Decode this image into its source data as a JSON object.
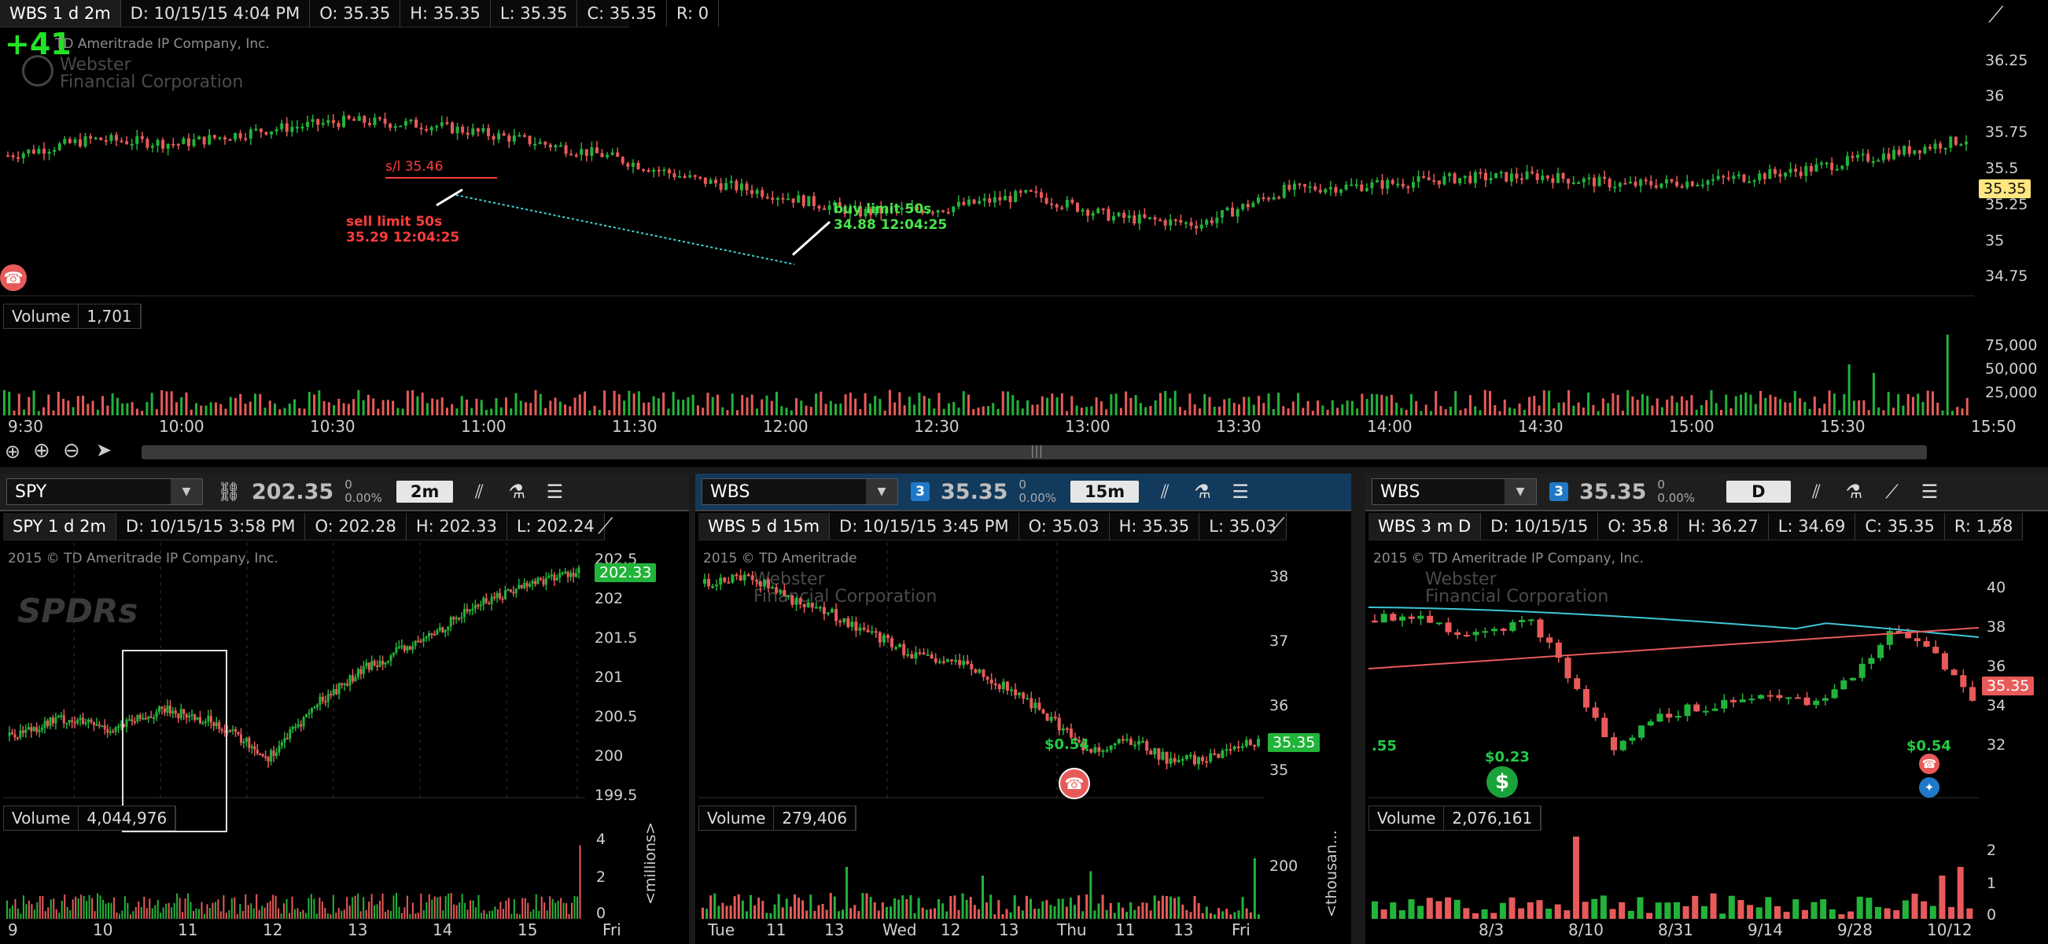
{
  "main": {
    "info": [
      "WBS 1 d 2m",
      "D: 10/15/15 4:04 PM",
      "O: 35.35",
      "H: 35.35",
      "L: 35.35",
      "C: 35.35",
      "R: 0"
    ],
    "pl": "+41",
    "copyright": "TD Ameritrade IP Company, Inc.",
    "watermark_l1": "Webster",
    "watermark_l2": "Financial Corporation",
    "price_ticks": [
      "36.25",
      "36",
      "35.75",
      "35.5",
      "35.25",
      "35",
      "34.75"
    ],
    "last_tag": "35.35",
    "order_label": "s/l 35.46",
    "sell_l1": "sell limit 50s",
    "sell_l2": "35.29 12:04:25",
    "buy_l1": "buy limit 50s",
    "buy_l2": "34.88 12:04:25",
    "volume_label": "Volume",
    "volume_value": "1,701",
    "vol_ticks": [
      "75,000",
      "50,000",
      "25,000"
    ],
    "time_ticks": [
      "9:30",
      "10:00",
      "10:30",
      "11:00",
      "11:30",
      "12:00",
      "12:30",
      "13:00",
      "13:30",
      "14:00",
      "14:30",
      "15:00",
      "15:30",
      "15:50"
    ],
    "colors": {
      "up": "#22b33a",
      "down": "#e85a5a",
      "accent": "#ffe680"
    },
    "candles_up_frac": 0.52
  },
  "panels": [
    {
      "symbol": "SPY",
      "price": "202.35",
      "change": "0",
      "change_pct": "0.00%",
      "timeframe": "2m",
      "info": [
        "SPY 1 d 2m",
        "D: 10/15/15 3:58 PM",
        "O: 202.28",
        "H: 202.33",
        "L: 202.24"
      ],
      "copyright": "2015 © TD Ameritrade IP Company, Inc.",
      "watermark": "SPDRs",
      "price_ticks": [
        "202.5",
        "202",
        "201.5",
        "201",
        "200.5",
        "200",
        "199.5"
      ],
      "last_tag": "202.33",
      "volume_label": "Volume",
      "volume_value": "4,044,976",
      "vol_ticks": [
        "4",
        "2",
        "0"
      ],
      "vol_unit": "<millions>",
      "time_ticks": [
        "9",
        "10",
        "11",
        "12",
        "13",
        "14",
        "15",
        "Fri"
      ],
      "trend": [
        0.22,
        0.3,
        0.25,
        0.34,
        0.28,
        0.12,
        0.38,
        0.55,
        0.66,
        0.82,
        0.92,
        0.98
      ]
    },
    {
      "symbol": "WBS",
      "price": "35.35",
      "change": "0",
      "change_pct": "0.00%",
      "timeframe": "15m",
      "linked": "3",
      "info": [
        "WBS 5 d 15m",
        "D: 10/15/15 3:45 PM",
        "O: 35.03",
        "H: 35.35",
        "L: 35.03"
      ],
      "copyright": "2015 © TD Ameritrade",
      "watermark_l1": "Webster",
      "watermark_l2": "Financial Corporation",
      "price_ticks": [
        "38",
        "37",
        "36",
        "35"
      ],
      "last_tag": "35.35",
      "earnings": "$0.54",
      "volume_label": "Volume",
      "volume_value": "279,406",
      "vol_ticks": [
        "200"
      ],
      "vol_unit": "<thousan...",
      "time_ticks": [
        "Tue",
        "11",
        "13",
        "Wed",
        "12",
        "13",
        "Thu",
        "11",
        "13",
        "Fri"
      ],
      "trend": [
        0.92,
        0.96,
        0.85,
        0.78,
        0.68,
        0.58,
        0.55,
        0.45,
        0.32,
        0.15,
        0.2,
        0.1,
        0.12,
        0.2
      ]
    },
    {
      "symbol": "WBS",
      "price": "35.35",
      "change": "0",
      "change_pct": "0.00%",
      "timeframe": "D",
      "linked": "3",
      "info": [
        "WBS 3 m D",
        "D: 10/15/15",
        "O: 35.8",
        "H: 36.27",
        "L: 34.69",
        "C: 35.35",
        "R: 1.58"
      ],
      "copyright": "2015 © TD Ameritrade IP Company, Inc.",
      "watermark_l1": "Webster",
      "watermark_l2": "Financial Corporation",
      "price_ticks": [
        "40",
        "38",
        "36",
        "34",
        "32"
      ],
      "last_tag": "35.35",
      "div_left": ".55",
      "div_mid": "$0.23",
      "div_right": "$0.54",
      "volume_label": "Volume",
      "volume_value": "2,076,161",
      "vol_ticks": [
        "2",
        "1",
        "0"
      ],
      "time_ticks": [
        "8/3",
        "8/10",
        "8/31",
        "9/14",
        "9/28",
        "10/12"
      ],
      "trend": [
        0.75,
        0.78,
        0.7,
        0.72,
        0.74,
        0.45,
        0.15,
        0.3,
        0.35,
        0.38,
        0.42,
        0.35,
        0.5,
        0.7,
        0.62,
        0.38
      ]
    }
  ]
}
